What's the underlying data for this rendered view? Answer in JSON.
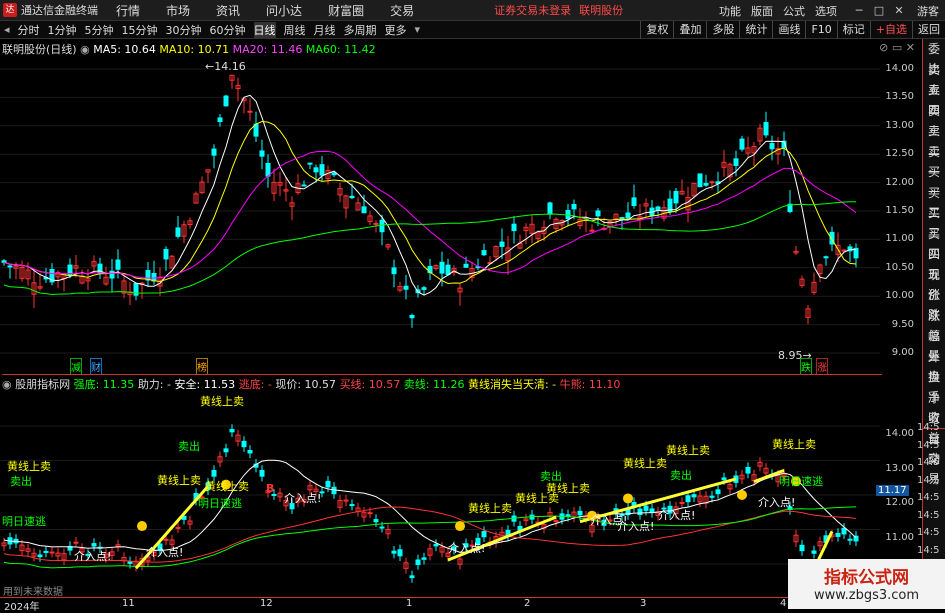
{
  "app": {
    "title": "通达信金融终端",
    "status_red": "证券交易未登录",
    "stock_red": "联明股份"
  },
  "menu": [
    "行情",
    "市场",
    "资讯",
    "问小达",
    "财富圈",
    "交易"
  ],
  "menu_right": [
    "功能",
    "版面",
    "公式",
    "选项",
    "游客"
  ],
  "periods": [
    "分时",
    "1分钟",
    "5分钟",
    "15分钟",
    "30分钟",
    "60分钟",
    "日线",
    "周线",
    "月线",
    "多周期",
    "更多"
  ],
  "active_period": "日线",
  "tools": [
    "复权",
    "叠加",
    "多股",
    "统计",
    "画线",
    "F10",
    "标记",
    "+自选",
    "返回"
  ],
  "sidebar_top": [
    "委比",
    "卖五",
    "卖四",
    "卖三",
    "卖二",
    "卖一",
    "买一",
    "买二",
    "买三",
    "买四",
    "买五",
    "现价",
    "涨跌",
    "涨幅",
    "总量",
    "外盘",
    "换手",
    "净资",
    "收益"
  ],
  "sidebar_bottom": [
    "自动",
    "交易"
  ],
  "main_legend": {
    "name": "联明股份(日线)",
    "ma5": "MA5: 10.64",
    "ma10": "MA10: 10.71",
    "ma20": "MA20: 11.46",
    "ma60": "MA60: 11.42"
  },
  "main_axis": [
    "14.00",
    "13.50",
    "13.00",
    "12.50",
    "12.00",
    "11.50",
    "11.00",
    "10.50",
    "10.00",
    "9.50",
    "9.00"
  ],
  "main_marks": {
    "high": "14.16",
    "low": "8.95",
    "b1": "减",
    "b2": "财",
    "b3": "榜",
    "b4": "跌",
    "b5": "涨"
  },
  "sub_legend": {
    "name": "股朋指标网",
    "l1": "强底: 11.35",
    "l2": "助力: -",
    "l3": "安全: 11.53",
    "l4": "逃底: -",
    "l5": "现价: 10.57",
    "l6": "买线: 10.57",
    "l7": "卖线: 11.26",
    "l8": "黄线消失当天清: -",
    "l9": "牛熊: 11.10"
  },
  "sub_axis": [
    "14.00",
    "13.00",
    "12.00",
    "11.00",
    "10.00"
  ],
  "sub_right_axis": [
    "14:5",
    "14:5",
    "14:5",
    "14:5",
    "14:5",
    "14:5",
    "14:5",
    "14:5",
    "14:5"
  ],
  "price_tag": "11.17",
  "annotations": {
    "sell": "黄线上卖",
    "out": "卖出",
    "tomorrow": "明日速逃",
    "entry": "介入点!",
    "b": "B"
  },
  "no_future": "用到未来数据",
  "dates": [
    "2024年",
    "11",
    "12",
    "1",
    "2",
    "3",
    "4"
  ],
  "watermark": {
    "line1": "指标公式网",
    "line2": "www.zbgs3.com"
  },
  "colors": {
    "up": "#ff3232",
    "down": "#00ffff",
    "ma5": "#ffffff",
    "ma10": "#ffff00",
    "ma20": "#ff00ff",
    "ma60": "#00ff00"
  }
}
